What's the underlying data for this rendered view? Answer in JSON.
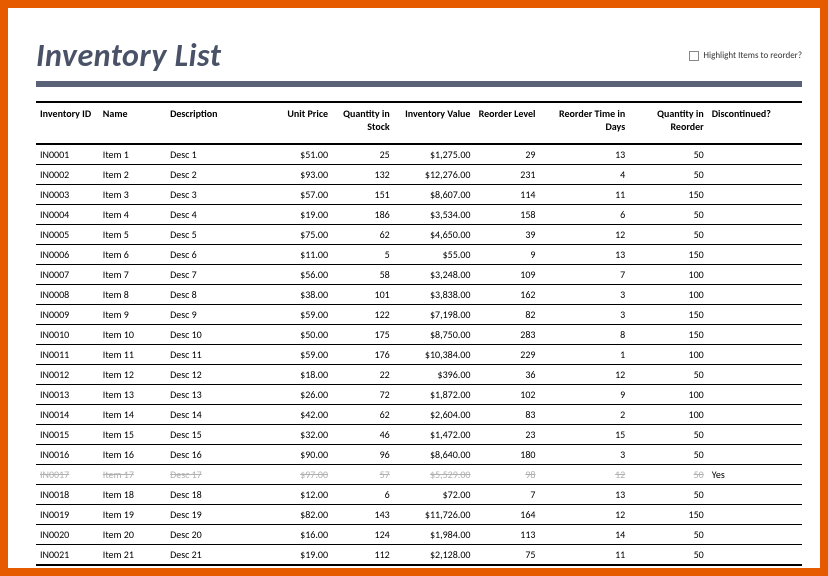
{
  "title": "Inventory List",
  "highlight_label": "Highlight Items to reorder?",
  "columns": {
    "id": "Inventory ID",
    "name": "Name",
    "desc": "Description",
    "unit_price": "Unit Price",
    "qty_stock": "Quantity in Stock",
    "inv_value": "Inventory Value",
    "reorder_level": "Reorder Level",
    "reorder_time": "Reorder Time in Days",
    "qty_reorder": "Quantity in Reorder",
    "discontinued": "Discontinued?"
  },
  "rows": [
    {
      "id": "IN0001",
      "name": "Item 1",
      "desc": "Desc 1",
      "unit_price": "$51.00",
      "qty_stock": "25",
      "inv_value": "$1,275.00",
      "reorder_level": "29",
      "reorder_time": "13",
      "qty_reorder": "50",
      "discontinued": ""
    },
    {
      "id": "IN0002",
      "name": "Item 2",
      "desc": "Desc 2",
      "unit_price": "$93.00",
      "qty_stock": "132",
      "inv_value": "$12,276.00",
      "reorder_level": "231",
      "reorder_time": "4",
      "qty_reorder": "50",
      "discontinued": ""
    },
    {
      "id": "IN0003",
      "name": "Item 3",
      "desc": "Desc 3",
      "unit_price": "$57.00",
      "qty_stock": "151",
      "inv_value": "$8,607.00",
      "reorder_level": "114",
      "reorder_time": "11",
      "qty_reorder": "150",
      "discontinued": ""
    },
    {
      "id": "IN0004",
      "name": "Item 4",
      "desc": "Desc 4",
      "unit_price": "$19.00",
      "qty_stock": "186",
      "inv_value": "$3,534.00",
      "reorder_level": "158",
      "reorder_time": "6",
      "qty_reorder": "50",
      "discontinued": ""
    },
    {
      "id": "IN0005",
      "name": "Item 5",
      "desc": "Desc 5",
      "unit_price": "$75.00",
      "qty_stock": "62",
      "inv_value": "$4,650.00",
      "reorder_level": "39",
      "reorder_time": "12",
      "qty_reorder": "50",
      "discontinued": ""
    },
    {
      "id": "IN0006",
      "name": "Item 6",
      "desc": "Desc 6",
      "unit_price": "$11.00",
      "qty_stock": "5",
      "inv_value": "$55.00",
      "reorder_level": "9",
      "reorder_time": "13",
      "qty_reorder": "150",
      "discontinued": ""
    },
    {
      "id": "IN0007",
      "name": "Item 7",
      "desc": "Desc 7",
      "unit_price": "$56.00",
      "qty_stock": "58",
      "inv_value": "$3,248.00",
      "reorder_level": "109",
      "reorder_time": "7",
      "qty_reorder": "100",
      "discontinued": ""
    },
    {
      "id": "IN0008",
      "name": "Item 8",
      "desc": "Desc 8",
      "unit_price": "$38.00",
      "qty_stock": "101",
      "inv_value": "$3,838.00",
      "reorder_level": "162",
      "reorder_time": "3",
      "qty_reorder": "100",
      "discontinued": ""
    },
    {
      "id": "IN0009",
      "name": "Item 9",
      "desc": "Desc 9",
      "unit_price": "$59.00",
      "qty_stock": "122",
      "inv_value": "$7,198.00",
      "reorder_level": "82",
      "reorder_time": "3",
      "qty_reorder": "150",
      "discontinued": ""
    },
    {
      "id": "IN0010",
      "name": "Item 10",
      "desc": "Desc 10",
      "unit_price": "$50.00",
      "qty_stock": "175",
      "inv_value": "$8,750.00",
      "reorder_level": "283",
      "reorder_time": "8",
      "qty_reorder": "150",
      "discontinued": ""
    },
    {
      "id": "IN0011",
      "name": "Item 11",
      "desc": "Desc 11",
      "unit_price": "$59.00",
      "qty_stock": "176",
      "inv_value": "$10,384.00",
      "reorder_level": "229",
      "reorder_time": "1",
      "qty_reorder": "100",
      "discontinued": ""
    },
    {
      "id": "IN0012",
      "name": "Item 12",
      "desc": "Desc 12",
      "unit_price": "$18.00",
      "qty_stock": "22",
      "inv_value": "$396.00",
      "reorder_level": "36",
      "reorder_time": "12",
      "qty_reorder": "50",
      "discontinued": ""
    },
    {
      "id": "IN0013",
      "name": "Item 13",
      "desc": "Desc 13",
      "unit_price": "$26.00",
      "qty_stock": "72",
      "inv_value": "$1,872.00",
      "reorder_level": "102",
      "reorder_time": "9",
      "qty_reorder": "100",
      "discontinued": ""
    },
    {
      "id": "IN0014",
      "name": "Item 14",
      "desc": "Desc 14",
      "unit_price": "$42.00",
      "qty_stock": "62",
      "inv_value": "$2,604.00",
      "reorder_level": "83",
      "reorder_time": "2",
      "qty_reorder": "100",
      "discontinued": ""
    },
    {
      "id": "IN0015",
      "name": "Item 15",
      "desc": "Desc 15",
      "unit_price": "$32.00",
      "qty_stock": "46",
      "inv_value": "$1,472.00",
      "reorder_level": "23",
      "reorder_time": "15",
      "qty_reorder": "50",
      "discontinued": ""
    },
    {
      "id": "IN0016",
      "name": "Item 16",
      "desc": "Desc 16",
      "unit_price": "$90.00",
      "qty_stock": "96",
      "inv_value": "$8,640.00",
      "reorder_level": "180",
      "reorder_time": "3",
      "qty_reorder": "50",
      "discontinued": ""
    },
    {
      "id": "IN0017",
      "name": "Item 17",
      "desc": "Desc 17",
      "unit_price": "$97.00",
      "qty_stock": "57",
      "inv_value": "$5,529.00",
      "reorder_level": "98",
      "reorder_time": "12",
      "qty_reorder": "50",
      "discontinued": "Yes",
      "is_discontinued": true
    },
    {
      "id": "IN0018",
      "name": "Item 18",
      "desc": "Desc 18",
      "unit_price": "$12.00",
      "qty_stock": "6",
      "inv_value": "$72.00",
      "reorder_level": "7",
      "reorder_time": "13",
      "qty_reorder": "50",
      "discontinued": ""
    },
    {
      "id": "IN0019",
      "name": "Item 19",
      "desc": "Desc 19",
      "unit_price": "$82.00",
      "qty_stock": "143",
      "inv_value": "$11,726.00",
      "reorder_level": "164",
      "reorder_time": "12",
      "qty_reorder": "150",
      "discontinued": ""
    },
    {
      "id": "IN0020",
      "name": "Item 20",
      "desc": "Desc 20",
      "unit_price": "$16.00",
      "qty_stock": "124",
      "inv_value": "$1,984.00",
      "reorder_level": "113",
      "reorder_time": "14",
      "qty_reorder": "50",
      "discontinued": ""
    },
    {
      "id": "IN0021",
      "name": "Item 21",
      "desc": "Desc 21",
      "unit_price": "$19.00",
      "qty_stock": "112",
      "inv_value": "$2,128.00",
      "reorder_level": "75",
      "reorder_time": "11",
      "qty_reorder": "50",
      "discontinued": ""
    }
  ]
}
